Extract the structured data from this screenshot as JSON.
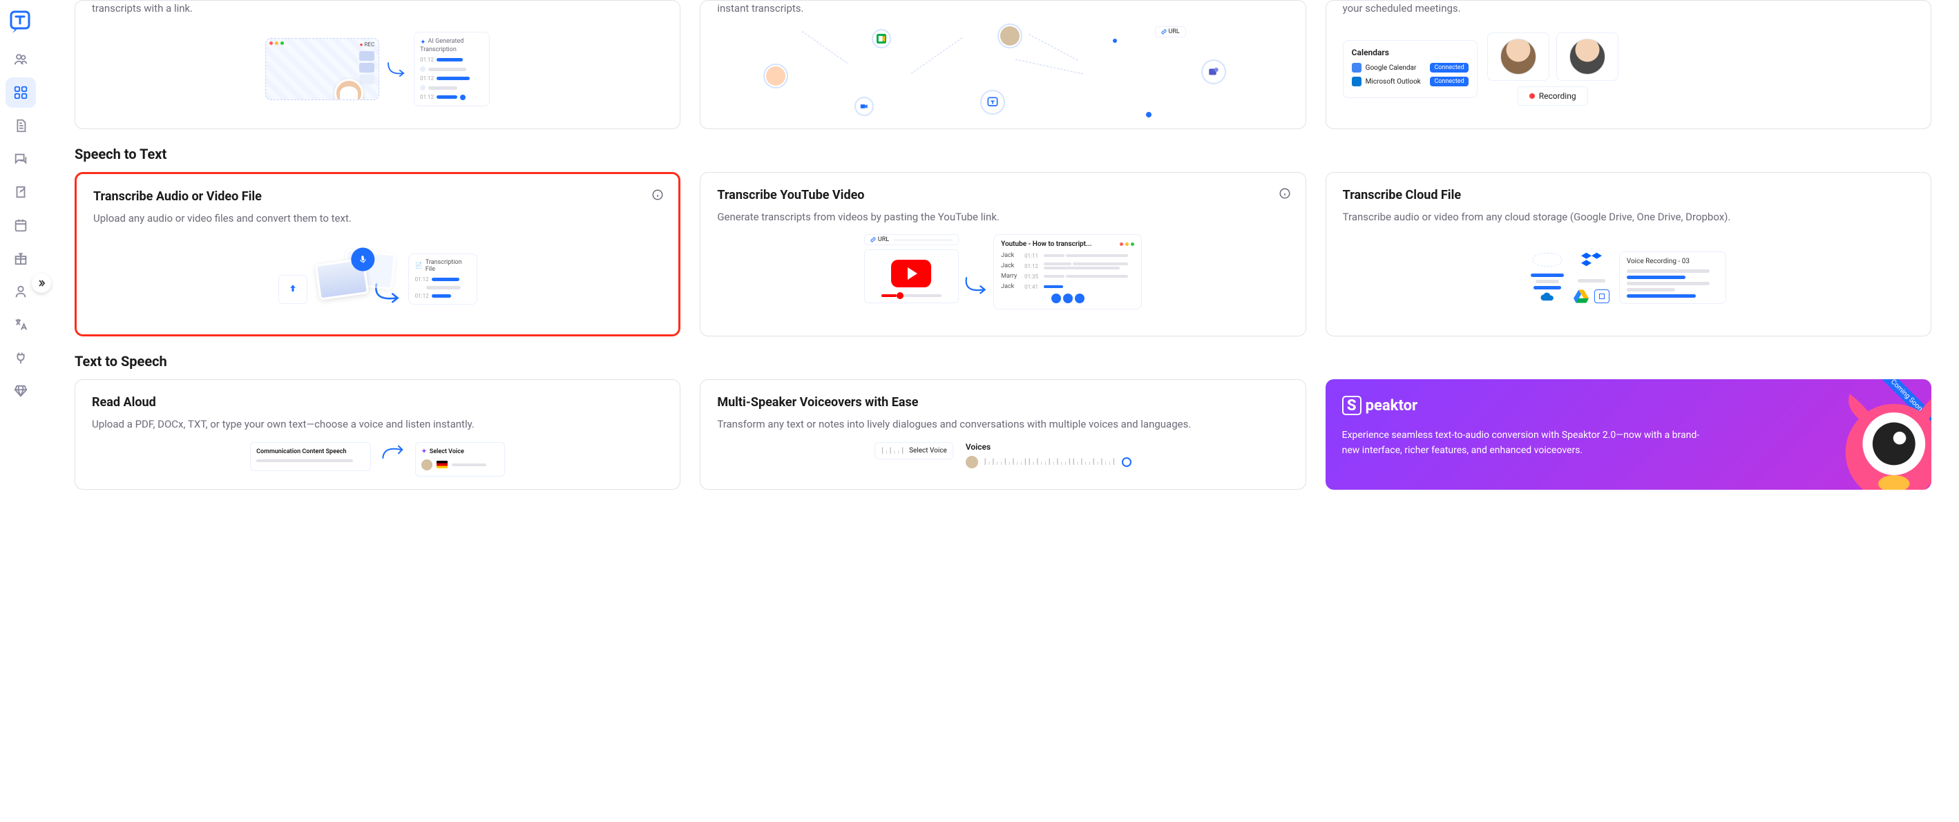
{
  "brand": "T",
  "topCards": [
    {
      "desc_suffix": "transcripts with a link.",
      "mini": {
        "rec": "REC",
        "ai_title": "AI Generated",
        "ai_sub": "Transcription",
        "times": [
          "01:12",
          "01:12",
          "01:12"
        ]
      }
    },
    {
      "desc_suffix": "instant transcripts.",
      "mini": {
        "url": "URL"
      }
    },
    {
      "desc_suffix": "your scheduled meetings.",
      "cal": {
        "title": "Calendars",
        "rows": [
          {
            "label": "Google Calendar",
            "btn": "Connected",
            "color": "#4285f4"
          },
          {
            "label": "Microsoft Outlook",
            "btn": "Connected",
            "color": "#0078d4"
          }
        ],
        "recording": "Recording"
      }
    }
  ],
  "sections": {
    "stt": {
      "title": "Speech to Text",
      "cards": [
        {
          "title": "Transcribe Audio or Video File",
          "desc": "Upload any audio or video files and convert them to text.",
          "file_label": "Transcription File",
          "times": [
            "01:12",
            "01:12"
          ]
        },
        {
          "title": "Transcribe YouTube Video",
          "desc": "Generate transcripts from videos by pasting the YouTube link.",
          "url_label": "URL",
          "yt": {
            "title": "Youtube - How to transcript...",
            "rows": [
              {
                "name": "Jack",
                "time": "01:11"
              },
              {
                "name": "Jack",
                "time": "01:12"
              },
              {
                "name": "Marry",
                "time": "01:35"
              },
              {
                "name": "Jack",
                "time": "01:41"
              }
            ]
          }
        },
        {
          "title": "Transcribe Cloud File",
          "desc": "Transcribe audio or video from any cloud storage (Google Drive, One Drive, Dropbox).",
          "file_label": "Voice Recording - 03"
        }
      ]
    },
    "tts": {
      "title": "Text to Speech",
      "cards": [
        {
          "title": "Read Aloud",
          "desc": "Upload a PDF, DOCx, TXT, or type your own text—choose a voice and listen instantly.",
          "speech_label": "Communication Content Speech",
          "voice_label": "Select Voice"
        },
        {
          "title": "Multi-Speaker Voiceovers with Ease",
          "desc": "Transform any text or notes into lively dialogues and conversations with multiple voices and languages.",
          "select_voice": "Select Voice",
          "voices": "Voices"
        },
        {
          "promo": true,
          "logo": "peaktor",
          "text": "Experience seamless text-to-audio conversion with Speaktor 2.0—now with a brand-new interface, richer features, and enhanced voiceovers.",
          "badge": "Coming Soon"
        }
      ]
    }
  }
}
